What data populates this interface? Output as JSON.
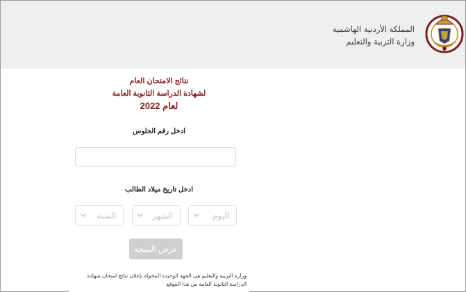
{
  "header": {
    "kingdom_name": "المملكة الأردنية الهاشمية",
    "ministry_name": "وزارة التربية والتعليم",
    "logo_icon": "jordan-coat-of-arms-icon"
  },
  "results": {
    "title_line1": "نتائج الامتحان العام",
    "title_line2": "لشهادة الدراسة الثانوية العامة",
    "title_line3": "لعام 2022"
  },
  "form": {
    "seat_label": "ادخل رقم الجلوس",
    "seat_value": "",
    "dob_label": "ادخل تاريخ ميلاد الطالب",
    "year_placeholder": "السنة",
    "month_placeholder": "الشهر",
    "day_placeholder": "اليوم",
    "submit_label": "عرض النتيجة"
  },
  "footer": {
    "disclaimer": "وزارة التربية والتعليم هي الجهة الوحيدة المخولة بإعلان نتائج امتحان شهادة الدراسة الثانوية العامة من هذا الموقع"
  },
  "colors": {
    "title": "#8b1e1e",
    "header_bg": "#efefef",
    "button_disabled": "#cfcfcf"
  }
}
